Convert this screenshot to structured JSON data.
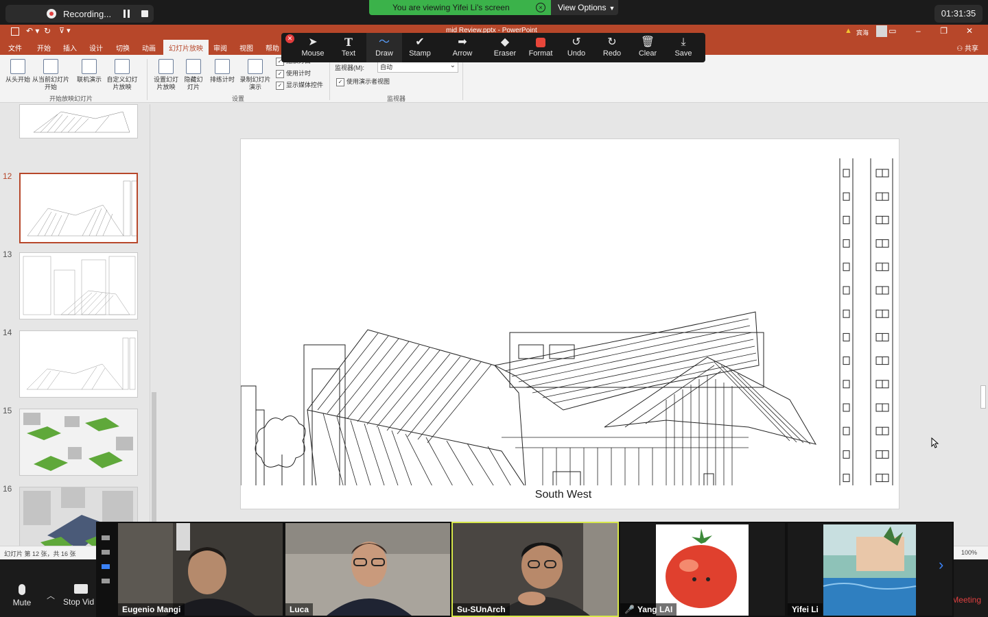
{
  "zoom": {
    "recording_label": "Recording...",
    "viewing_banner": "You are viewing Yifei Li's screen",
    "view_options_label": "View Options",
    "timer": "01:31:35",
    "mute_label": "Mute",
    "stop_video_label": "Stop Vid",
    "meeting_label": "Meeting"
  },
  "annotation_toolbar": {
    "tools": [
      {
        "label": "Mouse",
        "icon": "arrow-cursor-icon"
      },
      {
        "label": "Text",
        "icon": "text-T-icon"
      },
      {
        "label": "Draw",
        "icon": "squiggle-icon"
      },
      {
        "label": "Stamp",
        "icon": "checkmark-icon"
      },
      {
        "label": "Arrow",
        "icon": "arrow-right-icon"
      },
      {
        "label": "Eraser",
        "icon": "eraser-icon"
      },
      {
        "label": "Format",
        "icon": "color-square-icon"
      },
      {
        "label": "Undo",
        "icon": "undo-icon"
      },
      {
        "label": "Redo",
        "icon": "redo-icon"
      },
      {
        "label": "Clear",
        "icon": "trash-icon"
      },
      {
        "label": "Save",
        "icon": "download-icon"
      }
    ],
    "active_tool": "Draw",
    "format_color": "#e8463a"
  },
  "powerpoint": {
    "doc_title": "mid Review.pptx  -  PowerPoint",
    "user_name": "宾海",
    "share_label": "共享",
    "tabs": [
      "文件",
      "开始",
      "插入",
      "设计",
      "切换",
      "动画",
      "幻灯片放映",
      "审阅",
      "视图",
      "帮助"
    ],
    "active_tab": "幻灯片放映",
    "ribbon": {
      "from_beginning": "从头开始",
      "from_current": "从当前幻灯片开始",
      "online": "联机演示",
      "custom": "自定义幻灯片放映",
      "group_start": "开始放映幻灯片",
      "setup": "设置幻灯片放映",
      "hide": "隐藏幻灯片",
      "rehearse": "排练计时",
      "record": "录制幻灯片演示",
      "group_setup": "设置",
      "chk_narration": "播放旁白",
      "chk_timing": "使用计时",
      "chk_media": "显示媒体控件",
      "monitor_label": "监视器(M):",
      "monitor_value": "自动",
      "chk_presenter": "使用演示者视图",
      "group_monitor": "监视器"
    },
    "slide_numbers": [
      "12",
      "13",
      "14",
      "15",
      "16"
    ],
    "selected_slide": "12",
    "slide_caption": "South West",
    "status_text": "幻灯片 第 12 张，共 16 张",
    "zoom_percent": "100%"
  },
  "participants": [
    {
      "name": "Eugenio Mangi",
      "muted": false
    },
    {
      "name": "Luca",
      "muted": false
    },
    {
      "name": "Su-SUnArch",
      "muted": false,
      "speaking": true
    },
    {
      "name": "Yang LAI",
      "muted": true
    },
    {
      "name": "Yifei Li",
      "muted": false
    }
  ],
  "colors": {
    "ppt_accent": "#b7472a",
    "zoom_green": "#3bb24a",
    "speaker_outline": "#d8e84a"
  }
}
